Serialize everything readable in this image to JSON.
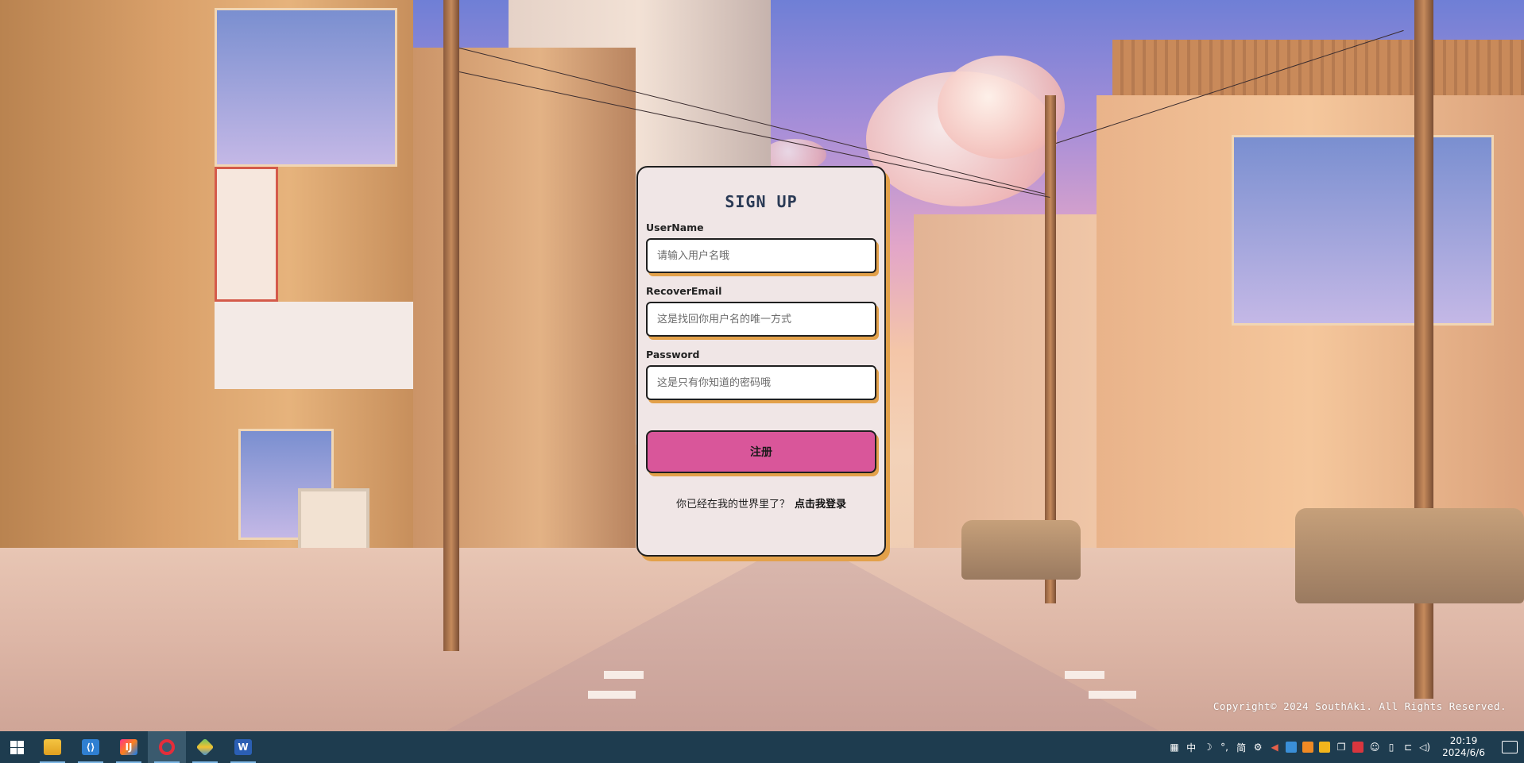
{
  "form": {
    "title": "SIGN UP",
    "username": {
      "label": "UserName",
      "placeholder": "请输入用户名哦",
      "value": ""
    },
    "recover_email": {
      "label": "RecoverEmail",
      "placeholder": "这是找回你用户名的唯一方式",
      "value": ""
    },
    "password": {
      "label": "Password",
      "placeholder": "这是只有你知道的密码哦",
      "value": ""
    },
    "submit_label": "注册",
    "login_prompt": "你已经在我的世界里了？",
    "login_link": "点击我登录"
  },
  "footer": {
    "copyright": "Copyright© 2024 SouthAki. All Rights Reserved."
  },
  "colors": {
    "card_bg": "#f0e6e6",
    "accent_shadow": "#e3a14a",
    "submit_bg": "#d9569a",
    "title": "#2a3a55",
    "taskbar": "#1e3c4f"
  },
  "taskbar": {
    "apps": [
      {
        "name": "file-explorer",
        "icon": "folder-icon",
        "active": false
      },
      {
        "name": "vscode",
        "icon": "vscode-icon",
        "active": false
      },
      {
        "name": "intellij",
        "icon": "intellij-icon",
        "active": false
      },
      {
        "name": "opera",
        "icon": "opera-icon",
        "active": true
      },
      {
        "name": "git-tool",
        "icon": "git-icon",
        "active": false
      },
      {
        "name": "word",
        "icon": "word-icon",
        "active": false
      }
    ],
    "tray": {
      "ime_mode": "中",
      "moon": "☽",
      "punct": "°,",
      "simplified": "简",
      "gear": "⚙",
      "volume": "🔊"
    },
    "time": "20:19",
    "date": "2024/6/6"
  }
}
